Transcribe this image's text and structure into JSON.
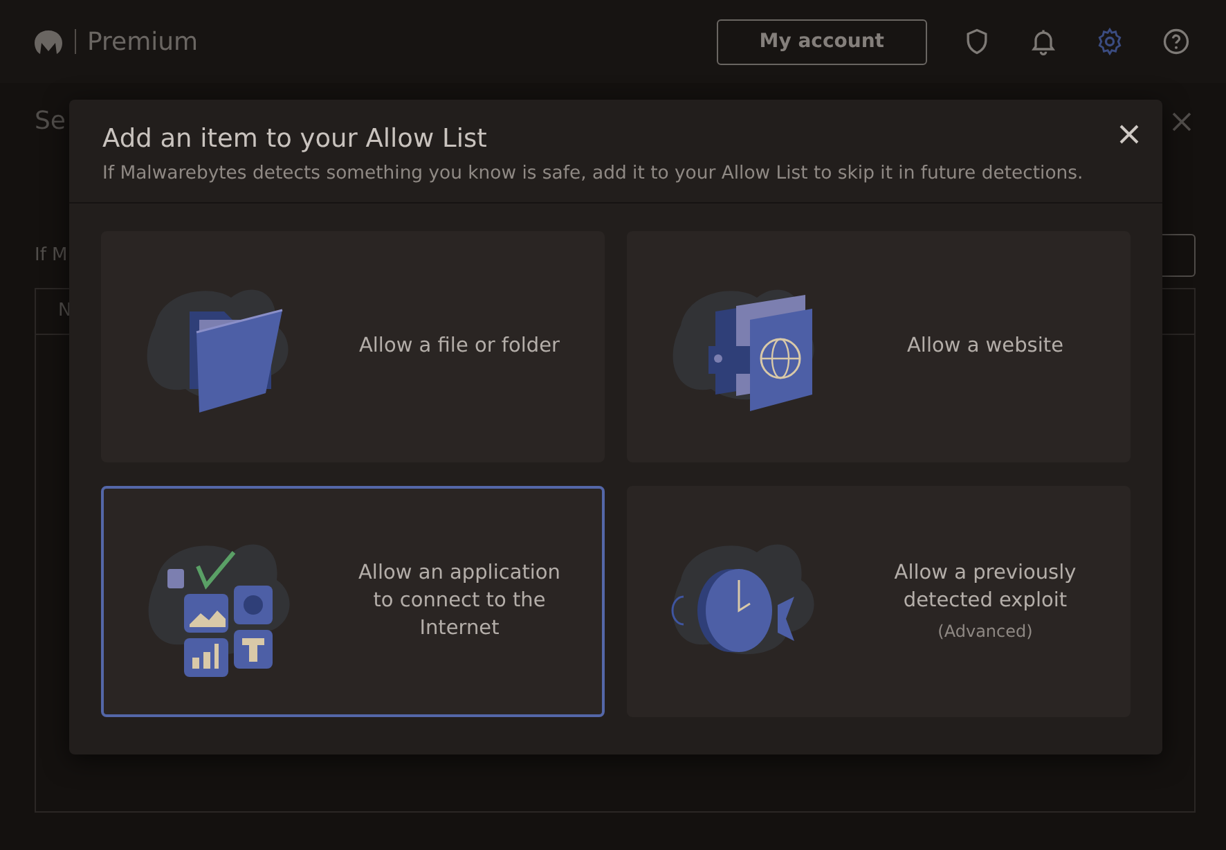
{
  "header": {
    "product": "Premium",
    "account_button": "My account",
    "toolbar": [
      {
        "kind": "shield",
        "selected": false
      },
      {
        "kind": "bell",
        "selected": false
      },
      {
        "kind": "gear",
        "selected": true
      },
      {
        "kind": "help",
        "selected": false
      }
    ]
  },
  "background": {
    "title": "Se",
    "intro": "If M",
    "column_1": "N"
  },
  "dialog": {
    "title": "Add an item to your Allow List",
    "subtitle": "If Malwarebytes detects something you know is safe, add it to your Allow List to skip it in future detections.",
    "options": [
      {
        "kind": "file",
        "label": "Allow a file or folder",
        "selected": false
      },
      {
        "kind": "website",
        "label": "Allow a website",
        "selected": false
      },
      {
        "kind": "application",
        "label": "Allow an application to connect to the Internet",
        "selected": true
      },
      {
        "kind": "exploit",
        "label": "Allow a previously detected exploit",
        "note": "(Advanced)",
        "selected": false
      }
    ]
  }
}
